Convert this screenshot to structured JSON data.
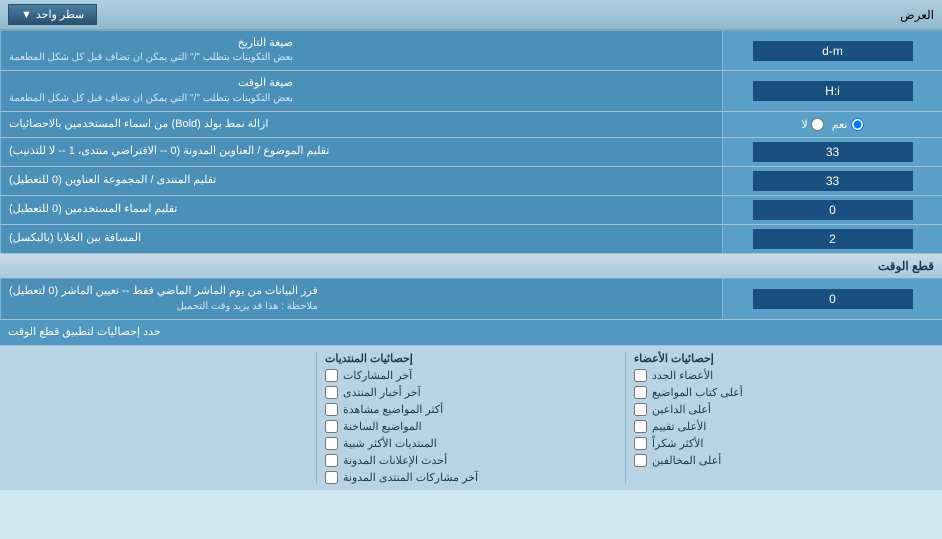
{
  "header": {
    "title": "العرض",
    "dropdown_label": "سطر واحد"
  },
  "rows": [
    {
      "id": "date_format",
      "label": "صيغة التاريخ",
      "sublabel": "بعض التكوينات يتطلب \"/\" التي يمكن ان تضاف قبل كل شكل المطعمة",
      "input_value": "d-m"
    },
    {
      "id": "time_format",
      "label": "صيغة الوقت",
      "sublabel": "بعض التكوينات يتطلب \"/\" التي يمكن ان تضاف قبل كل شكل المطعمة",
      "input_value": "H:i"
    },
    {
      "id": "bold_remove",
      "label": "ازالة نمط بولد (Bold) من اسماء المستخدمين بالاحصائيات",
      "radio_options": [
        "نعم",
        "لا"
      ],
      "radio_selected": "نعم"
    },
    {
      "id": "subject_order",
      "label": "تقليم الموضوع / العناوين المدونة (0 -- الافتراضي منتدى، 1 -- لا للتذنيب)",
      "input_value": "33"
    },
    {
      "id": "forum_order",
      "label": "تقليم المنتدى / المجموعة العناوين (0 للتعطيل)",
      "input_value": "33"
    },
    {
      "id": "username_trim",
      "label": "تقليم اسماء المستخدمين (0 للتعطيل)",
      "input_value": "0"
    },
    {
      "id": "cell_spacing",
      "label": "المسافة بين الخلايا (بالبكسل)",
      "input_value": "2"
    }
  ],
  "section_cutoff": {
    "title": "قطع الوقت",
    "row": {
      "label": "فرز البيانات من يوم الماشر الماضي فقط -- تعيين الماشر (0 لتعطيل)",
      "note": "ملاحظة : هذا قد يزيد وقت التحميل",
      "input_value": "0"
    },
    "stats_label": "حدد إحصاليات لتطبيق قطع الوقت"
  },
  "checkboxes": {
    "col1_header": "إحصائيات الأعضاء",
    "col1_items": [
      "الأعضاء الجدد",
      "أعلى كتاب المواضيع",
      "أعلى الداعين",
      "الأعلى تقييم",
      "الأكثر شكراً",
      "أعلى المخالفين"
    ],
    "col2_header": "إحصائيات المنتديات",
    "col2_items": [
      "آخر المشاركات",
      "آخر أخبار المنتدى",
      "أكثر المواضيع مشاهدة",
      "المواضيع الساخنة",
      "المنتديات الأكثر شبية",
      "أحدث الإعلانات المدونة",
      "آخر مشاركات المنتدى المدونة"
    ]
  }
}
